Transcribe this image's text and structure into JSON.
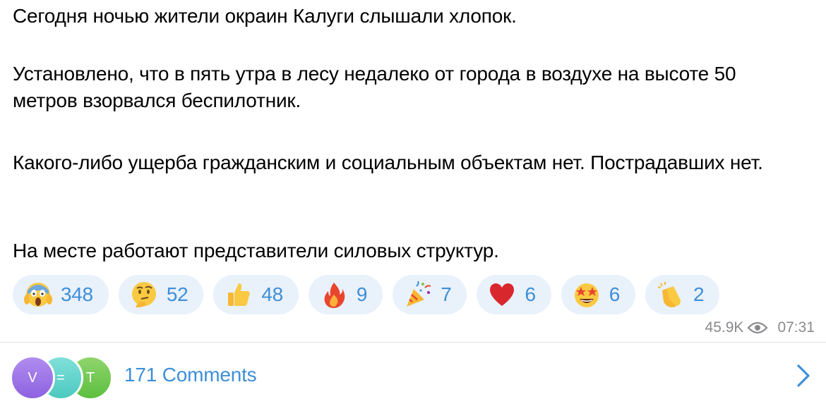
{
  "message": {
    "paragraphs": [
      "Сегодня ночью жители окраин Калуги слышали хлопок.",
      "Установлено, что в пять утра в лесу недалеко от города в воздухе на высоте 50 метров взорвался беспилотник.",
      "Какого-либо ущерба гражданским и социальным объектам нет. Пострадавших нет.",
      "На месте работают представители силовых структур."
    ]
  },
  "reactions": [
    {
      "icon": "screaming-face-icon",
      "count": "348"
    },
    {
      "icon": "thinking-face-icon",
      "count": "52"
    },
    {
      "icon": "thumbs-up-icon",
      "count": "48"
    },
    {
      "icon": "fire-icon",
      "count": "9"
    },
    {
      "icon": "party-popper-icon",
      "count": "7"
    },
    {
      "icon": "red-heart-icon",
      "count": "6"
    },
    {
      "icon": "star-struck-icon",
      "count": "6"
    },
    {
      "icon": "clapping-hands-icon",
      "count": "2"
    }
  ],
  "meta": {
    "views": "45.9K",
    "time": "07:31"
  },
  "comments": {
    "label": "171 Comments",
    "avatars": [
      "V",
      "=",
      "T"
    ]
  },
  "colors": {
    "accent": "#3d8fd9",
    "reaction_bg": "#e9f1fb",
    "meta_text": "#8a8a8e"
  }
}
